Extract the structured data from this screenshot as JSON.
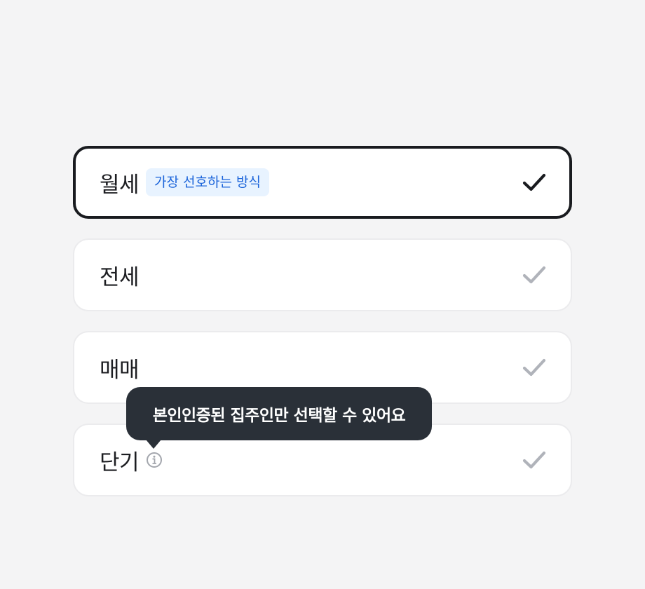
{
  "options": [
    {
      "label": "월세",
      "badge": "가장 선호하는 방식",
      "selected": true,
      "check_icon": "check-icon"
    },
    {
      "label": "전세",
      "selected": false,
      "check_icon": "check-icon"
    },
    {
      "label": "매매",
      "selected": false,
      "check_icon": "check-icon"
    },
    {
      "label": "단기",
      "selected": false,
      "check_icon": "check-icon",
      "info_icon": "info-icon"
    }
  ],
  "tooltip": {
    "text": "본인인증된 집주인만 선택할 수 있어요"
  },
  "colors": {
    "background": "#f4f4f5",
    "card": "#ffffff",
    "selected_border": "#191b1f",
    "check_active": "#191b1f",
    "check_inactive": "#b0b3ba",
    "badge_bg": "#e8f3ff",
    "badge_text": "#1b64da",
    "tooltip_bg": "#2a3038"
  }
}
